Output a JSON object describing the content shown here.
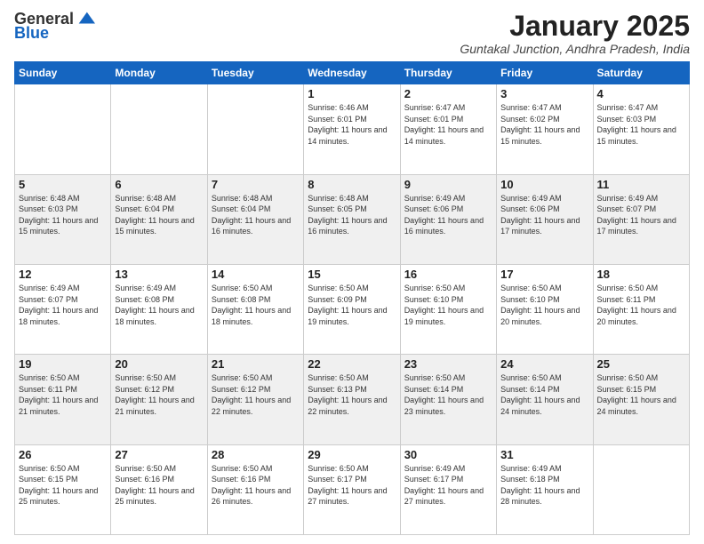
{
  "header": {
    "logo_general": "General",
    "logo_blue": "Blue",
    "month_title": "January 2025",
    "location": "Guntakal Junction, Andhra Pradesh, India"
  },
  "days_of_week": [
    "Sunday",
    "Monday",
    "Tuesday",
    "Wednesday",
    "Thursday",
    "Friday",
    "Saturday"
  ],
  "weeks": [
    [
      {
        "day": "",
        "sunrise": "",
        "sunset": "",
        "daylight": ""
      },
      {
        "day": "",
        "sunrise": "",
        "sunset": "",
        "daylight": ""
      },
      {
        "day": "",
        "sunrise": "",
        "sunset": "",
        "daylight": ""
      },
      {
        "day": "1",
        "sunrise": "Sunrise: 6:46 AM",
        "sunset": "Sunset: 6:01 PM",
        "daylight": "Daylight: 11 hours and 14 minutes."
      },
      {
        "day": "2",
        "sunrise": "Sunrise: 6:47 AM",
        "sunset": "Sunset: 6:01 PM",
        "daylight": "Daylight: 11 hours and 14 minutes."
      },
      {
        "day": "3",
        "sunrise": "Sunrise: 6:47 AM",
        "sunset": "Sunset: 6:02 PM",
        "daylight": "Daylight: 11 hours and 15 minutes."
      },
      {
        "day": "4",
        "sunrise": "Sunrise: 6:47 AM",
        "sunset": "Sunset: 6:03 PM",
        "daylight": "Daylight: 11 hours and 15 minutes."
      }
    ],
    [
      {
        "day": "5",
        "sunrise": "Sunrise: 6:48 AM",
        "sunset": "Sunset: 6:03 PM",
        "daylight": "Daylight: 11 hours and 15 minutes."
      },
      {
        "day": "6",
        "sunrise": "Sunrise: 6:48 AM",
        "sunset": "Sunset: 6:04 PM",
        "daylight": "Daylight: 11 hours and 15 minutes."
      },
      {
        "day": "7",
        "sunrise": "Sunrise: 6:48 AM",
        "sunset": "Sunset: 6:04 PM",
        "daylight": "Daylight: 11 hours and 16 minutes."
      },
      {
        "day": "8",
        "sunrise": "Sunrise: 6:48 AM",
        "sunset": "Sunset: 6:05 PM",
        "daylight": "Daylight: 11 hours and 16 minutes."
      },
      {
        "day": "9",
        "sunrise": "Sunrise: 6:49 AM",
        "sunset": "Sunset: 6:06 PM",
        "daylight": "Daylight: 11 hours and 16 minutes."
      },
      {
        "day": "10",
        "sunrise": "Sunrise: 6:49 AM",
        "sunset": "Sunset: 6:06 PM",
        "daylight": "Daylight: 11 hours and 17 minutes."
      },
      {
        "day": "11",
        "sunrise": "Sunrise: 6:49 AM",
        "sunset": "Sunset: 6:07 PM",
        "daylight": "Daylight: 11 hours and 17 minutes."
      }
    ],
    [
      {
        "day": "12",
        "sunrise": "Sunrise: 6:49 AM",
        "sunset": "Sunset: 6:07 PM",
        "daylight": "Daylight: 11 hours and 18 minutes."
      },
      {
        "day": "13",
        "sunrise": "Sunrise: 6:49 AM",
        "sunset": "Sunset: 6:08 PM",
        "daylight": "Daylight: 11 hours and 18 minutes."
      },
      {
        "day": "14",
        "sunrise": "Sunrise: 6:50 AM",
        "sunset": "Sunset: 6:08 PM",
        "daylight": "Daylight: 11 hours and 18 minutes."
      },
      {
        "day": "15",
        "sunrise": "Sunrise: 6:50 AM",
        "sunset": "Sunset: 6:09 PM",
        "daylight": "Daylight: 11 hours and 19 minutes."
      },
      {
        "day": "16",
        "sunrise": "Sunrise: 6:50 AM",
        "sunset": "Sunset: 6:10 PM",
        "daylight": "Daylight: 11 hours and 19 minutes."
      },
      {
        "day": "17",
        "sunrise": "Sunrise: 6:50 AM",
        "sunset": "Sunset: 6:10 PM",
        "daylight": "Daylight: 11 hours and 20 minutes."
      },
      {
        "day": "18",
        "sunrise": "Sunrise: 6:50 AM",
        "sunset": "Sunset: 6:11 PM",
        "daylight": "Daylight: 11 hours and 20 minutes."
      }
    ],
    [
      {
        "day": "19",
        "sunrise": "Sunrise: 6:50 AM",
        "sunset": "Sunset: 6:11 PM",
        "daylight": "Daylight: 11 hours and 21 minutes."
      },
      {
        "day": "20",
        "sunrise": "Sunrise: 6:50 AM",
        "sunset": "Sunset: 6:12 PM",
        "daylight": "Daylight: 11 hours and 21 minutes."
      },
      {
        "day": "21",
        "sunrise": "Sunrise: 6:50 AM",
        "sunset": "Sunset: 6:12 PM",
        "daylight": "Daylight: 11 hours and 22 minutes."
      },
      {
        "day": "22",
        "sunrise": "Sunrise: 6:50 AM",
        "sunset": "Sunset: 6:13 PM",
        "daylight": "Daylight: 11 hours and 22 minutes."
      },
      {
        "day": "23",
        "sunrise": "Sunrise: 6:50 AM",
        "sunset": "Sunset: 6:14 PM",
        "daylight": "Daylight: 11 hours and 23 minutes."
      },
      {
        "day": "24",
        "sunrise": "Sunrise: 6:50 AM",
        "sunset": "Sunset: 6:14 PM",
        "daylight": "Daylight: 11 hours and 24 minutes."
      },
      {
        "day": "25",
        "sunrise": "Sunrise: 6:50 AM",
        "sunset": "Sunset: 6:15 PM",
        "daylight": "Daylight: 11 hours and 24 minutes."
      }
    ],
    [
      {
        "day": "26",
        "sunrise": "Sunrise: 6:50 AM",
        "sunset": "Sunset: 6:15 PM",
        "daylight": "Daylight: 11 hours and 25 minutes."
      },
      {
        "day": "27",
        "sunrise": "Sunrise: 6:50 AM",
        "sunset": "Sunset: 6:16 PM",
        "daylight": "Daylight: 11 hours and 25 minutes."
      },
      {
        "day": "28",
        "sunrise": "Sunrise: 6:50 AM",
        "sunset": "Sunset: 6:16 PM",
        "daylight": "Daylight: 11 hours and 26 minutes."
      },
      {
        "day": "29",
        "sunrise": "Sunrise: 6:50 AM",
        "sunset": "Sunset: 6:17 PM",
        "daylight": "Daylight: 11 hours and 27 minutes."
      },
      {
        "day": "30",
        "sunrise": "Sunrise: 6:49 AM",
        "sunset": "Sunset: 6:17 PM",
        "daylight": "Daylight: 11 hours and 27 minutes."
      },
      {
        "day": "31",
        "sunrise": "Sunrise: 6:49 AM",
        "sunset": "Sunset: 6:18 PM",
        "daylight": "Daylight: 11 hours and 28 minutes."
      },
      {
        "day": "",
        "sunrise": "",
        "sunset": "",
        "daylight": ""
      }
    ]
  ]
}
